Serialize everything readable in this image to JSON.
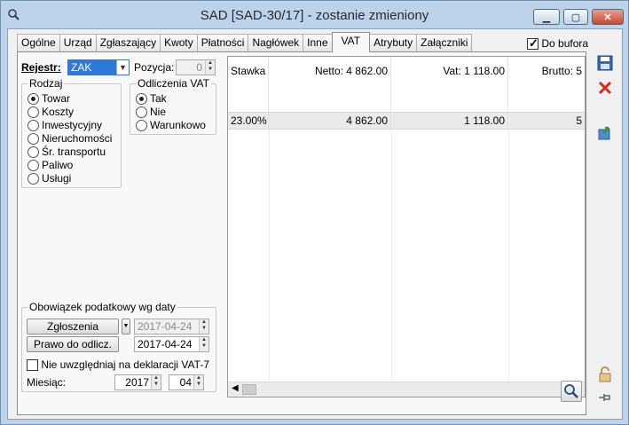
{
  "window": {
    "title": "SAD [SAD-30/17]  - zostanie zmieniony",
    "minimize": "▁",
    "maximize": "▢",
    "close": "✕"
  },
  "tabs": [
    "Ogólne",
    "Urząd",
    "Zgłaszający",
    "Kwoty",
    "Płatności",
    "Nagłówek",
    "Inne",
    "VAT",
    "Atrybuty",
    "Załączniki"
  ],
  "active_tab": "VAT",
  "do_bufora": {
    "label": "Do bufora",
    "checked": true
  },
  "rejestr": {
    "label": "Rejestr:",
    "value": "ZAK"
  },
  "pozycja": {
    "label": "Pozycja:",
    "value": "0"
  },
  "rodzaj": {
    "legend": "Rodzaj",
    "options": [
      "Towar",
      "Koszty",
      "Inwestycyjny",
      "Nieruchomości",
      "Śr. transportu",
      "Paliwo",
      "Usługi"
    ],
    "selected": "Towar"
  },
  "odliczenia": {
    "legend": "Odliczenia VAT",
    "options": [
      "Tak",
      "Nie",
      "Warunkowo"
    ],
    "selected": "Tak"
  },
  "obowiazek": {
    "legend": "Obowiązek podatkowy wg daty",
    "zgloszenia_label": "Zgłoszenia",
    "zgloszenia_date": "2017-04-24",
    "prawo_label": "Prawo do odlicz.",
    "prawo_date": "2017-04-24",
    "nie_uwzgledniaj": "Nie uwzględniaj na deklaracji VAT-7",
    "miesiac_label": "Miesiąc:",
    "rok": "2017",
    "miesiac": "04"
  },
  "grid": {
    "headers": [
      "Stawka",
      "Netto: 4 862.00",
      "Vat: 1 118.00",
      "Brutto: 5"
    ],
    "rows": [
      [
        "23.00%",
        "4 862.00",
        "1 118.00",
        "5"
      ]
    ]
  },
  "icons": [
    "save-icon",
    "cancel-icon",
    "export-icon",
    "unlock-icon",
    "pin-icon",
    "search-icon"
  ],
  "colors": {
    "window_frame": "#bcd3ea",
    "accent": "#3078d8",
    "close_red": "#c9482f"
  }
}
